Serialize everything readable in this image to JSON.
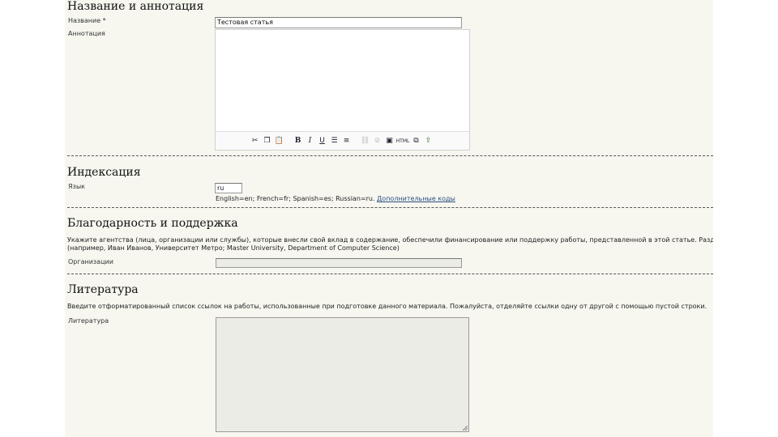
{
  "sections": {
    "title_abstract": {
      "heading": "Название и аннотация",
      "title_label": "Название *",
      "title_value": "Тестовая статья",
      "abstract_label": "Аннотация"
    },
    "indexing": {
      "heading": "Индексация",
      "language_label": "Язык",
      "language_value": "ru",
      "language_hint": "English=en; French=fr; Spanish=es; Russian=ru.",
      "language_link": "Дополнительные коды"
    },
    "support": {
      "heading": "Благодарность и поддержка",
      "description_line1": "Укажите агентства (лица, организации или службы), которые внесли свой вклад в содержание, обеспечили финансирование или поддержку работы, представленной в этой статье. Разделите",
      "description_line2": "(например, Иван Иванов, Университет Метро; Master University, Department of Computer Science)",
      "agencies_label": "Организации",
      "agencies_value": ""
    },
    "references": {
      "heading": "Литература",
      "description": "Введите отформатированный список ссылок на работы, использованные при подготовке данного материала. Пожалуйста, отделяйте ссылки одну от другой с помощью пустой строки.",
      "references_label": "Литература",
      "references_value": ""
    }
  },
  "editor_toolbar": {
    "icons": [
      "cut-icon",
      "copy-icon",
      "paste-icon",
      "bold-icon",
      "italic-icon",
      "underline-icon",
      "bullet-list-icon",
      "numbered-list-icon",
      "link-icon",
      "unlink-icon",
      "image-icon",
      "html-icon",
      "fullscreen-icon",
      "upload-icon"
    ],
    "html_label": "HTML"
  },
  "colors": {
    "panel_background": "#f7f7f0",
    "link": "#2a4f80"
  }
}
